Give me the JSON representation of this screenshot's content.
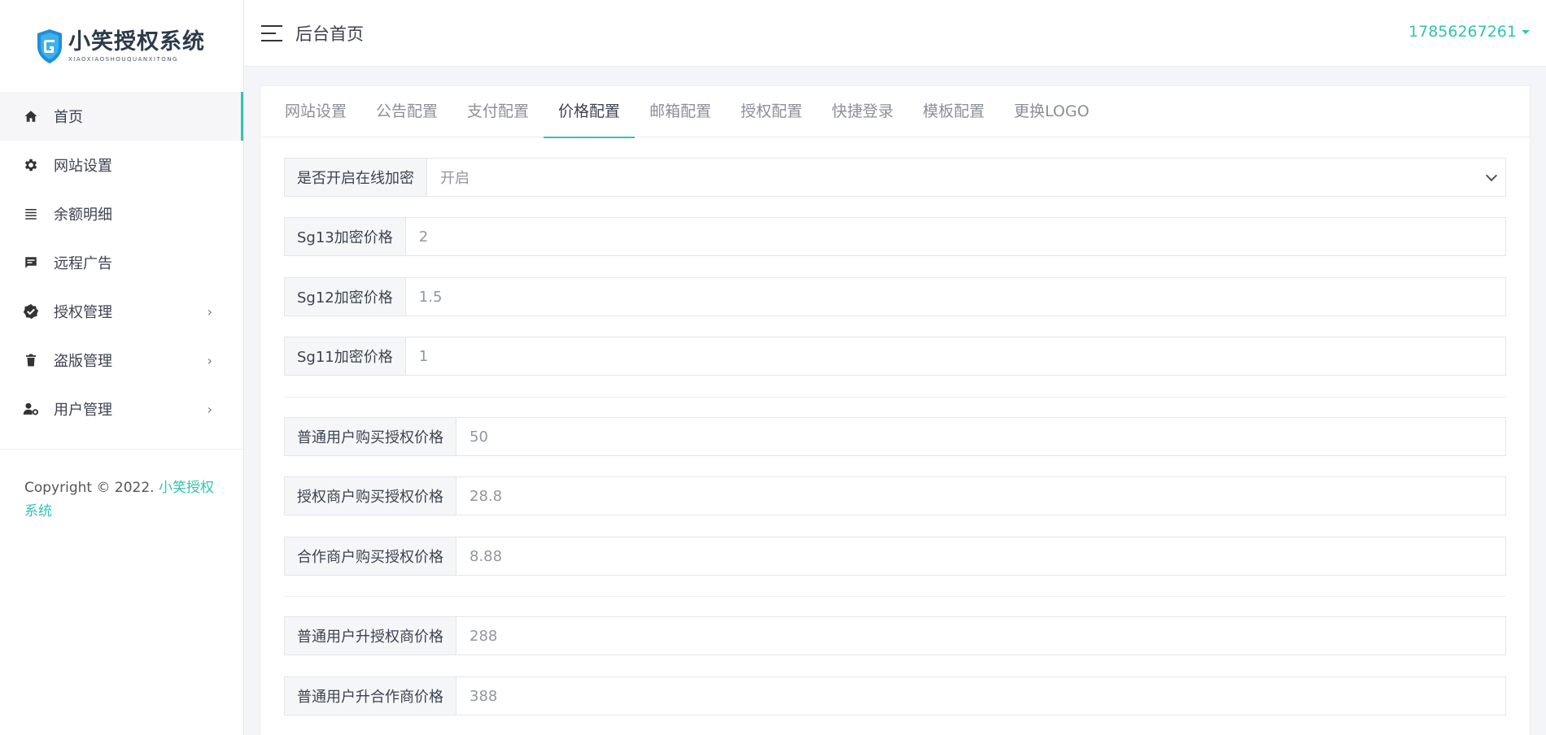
{
  "brand": {
    "title": "小笑授权系统",
    "subtitle": "XIAOXIAOSHOUQUANXITONG",
    "accent": "#33c3b1"
  },
  "sidebar": {
    "items": [
      {
        "label": "首页",
        "icon": "home-icon",
        "active": true
      },
      {
        "label": "网站设置",
        "icon": "gear-icon"
      },
      {
        "label": "余额明细",
        "icon": "list-icon"
      },
      {
        "label": "远程广告",
        "icon": "message-icon"
      },
      {
        "label": "授权管理",
        "icon": "verified-badge-icon",
        "has_children": true
      },
      {
        "label": "盗版管理",
        "icon": "trash-icon",
        "has_children": true
      },
      {
        "label": "用户管理",
        "icon": "user-settings-icon",
        "has_children": true
      }
    ],
    "arrow": "›",
    "copyright_prefix": "Copyright © 2022. ",
    "copyright_link": "小笑授权系统"
  },
  "header": {
    "title": "后台首页",
    "user": "17856267261"
  },
  "tabs": [
    {
      "label": "网站设置"
    },
    {
      "label": "公告配置"
    },
    {
      "label": "支付配置"
    },
    {
      "label": "价格配置",
      "active": true
    },
    {
      "label": "邮箱配置"
    },
    {
      "label": "授权配置"
    },
    {
      "label": "快捷登录"
    },
    {
      "label": "模板配置"
    },
    {
      "label": "更换LOGO"
    }
  ],
  "form": {
    "encrypt_online": {
      "label": "是否开启在线加密",
      "value": "开启"
    },
    "sg13": {
      "label": "Sg13加密价格",
      "value": "2"
    },
    "sg12": {
      "label": "Sg12加密价格",
      "value": "1.5"
    },
    "sg11": {
      "label": "Sg11加密价格",
      "value": "1"
    },
    "normal_buy": {
      "label": "普通用户购买授权价格",
      "value": "50"
    },
    "agent_buy": {
      "label": "授权商户购买授权价格",
      "value": "28.8"
    },
    "partner_buy": {
      "label": "合作商户购买授权价格",
      "value": "8.88"
    },
    "normal_to_agent": {
      "label": "普通用户升授权商价格",
      "value": "288"
    },
    "normal_to_partner": {
      "label": "普通用户升合作商价格",
      "value": "388"
    }
  }
}
